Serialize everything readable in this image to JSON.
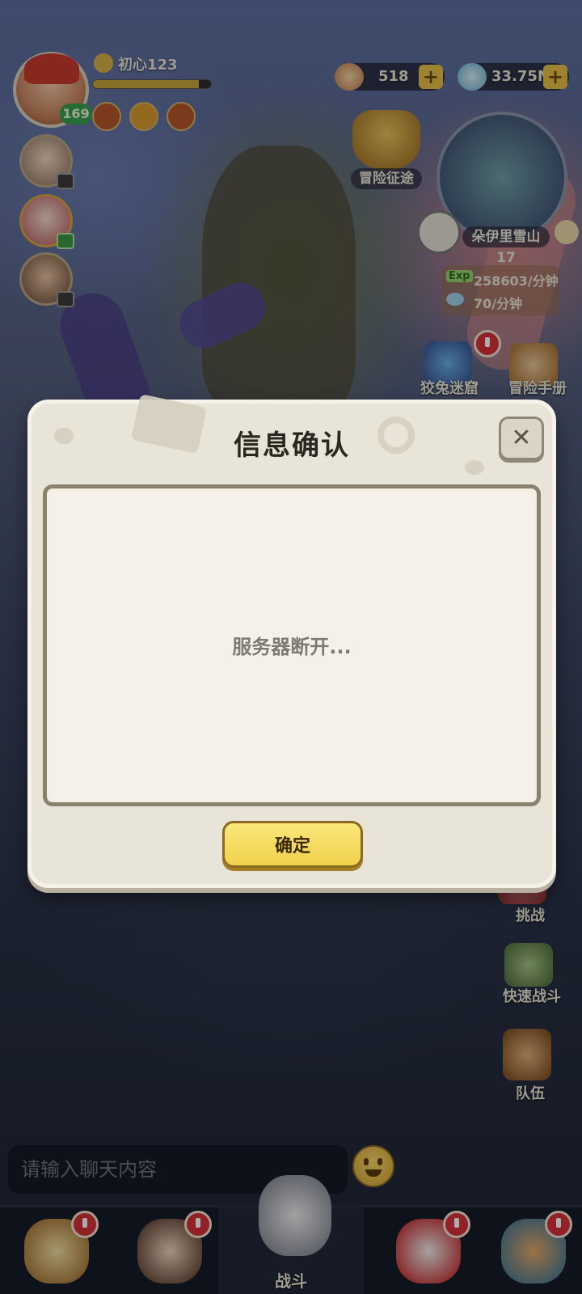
{
  "player": {
    "name": "初心123",
    "level": "169",
    "exp_fraction": 0.9
  },
  "currencies": [
    {
      "value": "518",
      "icon": "shell-icon"
    },
    {
      "value": "33.75M",
      "icon": "gem-icon"
    }
  ],
  "adventure_quest": {
    "label": "冒险征途"
  },
  "map": {
    "location": "朵伊里雪山17"
  },
  "rates": {
    "exp_tag": "Exp",
    "exp_rate": "258603/分钟",
    "gem_rate": "70/分钟"
  },
  "features": {
    "maze": "狡兔迷窟",
    "handbook": "冒险手册",
    "challenge": "挑战",
    "quick_battle": "快速战斗",
    "team": "队伍"
  },
  "chat": {
    "placeholder": "请输入聊天内容"
  },
  "bottom_nav": {
    "battle_label": "战斗"
  },
  "dialog": {
    "title": "信息确认",
    "close_label": "✕",
    "message": "服务器断开...",
    "confirm_label": "确定"
  },
  "colors": {
    "confirm_button": "#f1d14c",
    "alert_badge": "#d8313a",
    "level_badge": "#3aa050"
  }
}
